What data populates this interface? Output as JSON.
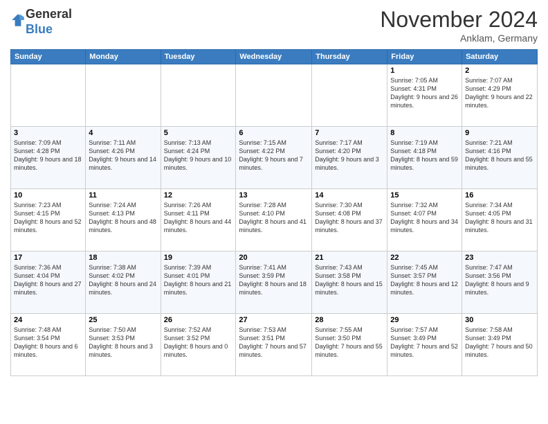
{
  "header": {
    "logo_general": "General",
    "logo_blue": "Blue",
    "month_title": "November 2024",
    "location": "Anklam, Germany"
  },
  "days_of_week": [
    "Sunday",
    "Monday",
    "Tuesday",
    "Wednesday",
    "Thursday",
    "Friday",
    "Saturday"
  ],
  "weeks": [
    [
      {
        "day": "",
        "info": ""
      },
      {
        "day": "",
        "info": ""
      },
      {
        "day": "",
        "info": ""
      },
      {
        "day": "",
        "info": ""
      },
      {
        "day": "",
        "info": ""
      },
      {
        "day": "1",
        "info": "Sunrise: 7:05 AM\nSunset: 4:31 PM\nDaylight: 9 hours and 26 minutes."
      },
      {
        "day": "2",
        "info": "Sunrise: 7:07 AM\nSunset: 4:29 PM\nDaylight: 9 hours and 22 minutes."
      }
    ],
    [
      {
        "day": "3",
        "info": "Sunrise: 7:09 AM\nSunset: 4:28 PM\nDaylight: 9 hours and 18 minutes."
      },
      {
        "day": "4",
        "info": "Sunrise: 7:11 AM\nSunset: 4:26 PM\nDaylight: 9 hours and 14 minutes."
      },
      {
        "day": "5",
        "info": "Sunrise: 7:13 AM\nSunset: 4:24 PM\nDaylight: 9 hours and 10 minutes."
      },
      {
        "day": "6",
        "info": "Sunrise: 7:15 AM\nSunset: 4:22 PM\nDaylight: 9 hours and 7 minutes."
      },
      {
        "day": "7",
        "info": "Sunrise: 7:17 AM\nSunset: 4:20 PM\nDaylight: 9 hours and 3 minutes."
      },
      {
        "day": "8",
        "info": "Sunrise: 7:19 AM\nSunset: 4:18 PM\nDaylight: 8 hours and 59 minutes."
      },
      {
        "day": "9",
        "info": "Sunrise: 7:21 AM\nSunset: 4:16 PM\nDaylight: 8 hours and 55 minutes."
      }
    ],
    [
      {
        "day": "10",
        "info": "Sunrise: 7:23 AM\nSunset: 4:15 PM\nDaylight: 8 hours and 52 minutes."
      },
      {
        "day": "11",
        "info": "Sunrise: 7:24 AM\nSunset: 4:13 PM\nDaylight: 8 hours and 48 minutes."
      },
      {
        "day": "12",
        "info": "Sunrise: 7:26 AM\nSunset: 4:11 PM\nDaylight: 8 hours and 44 minutes."
      },
      {
        "day": "13",
        "info": "Sunrise: 7:28 AM\nSunset: 4:10 PM\nDaylight: 8 hours and 41 minutes."
      },
      {
        "day": "14",
        "info": "Sunrise: 7:30 AM\nSunset: 4:08 PM\nDaylight: 8 hours and 37 minutes."
      },
      {
        "day": "15",
        "info": "Sunrise: 7:32 AM\nSunset: 4:07 PM\nDaylight: 8 hours and 34 minutes."
      },
      {
        "day": "16",
        "info": "Sunrise: 7:34 AM\nSunset: 4:05 PM\nDaylight: 8 hours and 31 minutes."
      }
    ],
    [
      {
        "day": "17",
        "info": "Sunrise: 7:36 AM\nSunset: 4:04 PM\nDaylight: 8 hours and 27 minutes."
      },
      {
        "day": "18",
        "info": "Sunrise: 7:38 AM\nSunset: 4:02 PM\nDaylight: 8 hours and 24 minutes."
      },
      {
        "day": "19",
        "info": "Sunrise: 7:39 AM\nSunset: 4:01 PM\nDaylight: 8 hours and 21 minutes."
      },
      {
        "day": "20",
        "info": "Sunrise: 7:41 AM\nSunset: 3:59 PM\nDaylight: 8 hours and 18 minutes."
      },
      {
        "day": "21",
        "info": "Sunrise: 7:43 AM\nSunset: 3:58 PM\nDaylight: 8 hours and 15 minutes."
      },
      {
        "day": "22",
        "info": "Sunrise: 7:45 AM\nSunset: 3:57 PM\nDaylight: 8 hours and 12 minutes."
      },
      {
        "day": "23",
        "info": "Sunrise: 7:47 AM\nSunset: 3:56 PM\nDaylight: 8 hours and 9 minutes."
      }
    ],
    [
      {
        "day": "24",
        "info": "Sunrise: 7:48 AM\nSunset: 3:54 PM\nDaylight: 8 hours and 6 minutes."
      },
      {
        "day": "25",
        "info": "Sunrise: 7:50 AM\nSunset: 3:53 PM\nDaylight: 8 hours and 3 minutes."
      },
      {
        "day": "26",
        "info": "Sunrise: 7:52 AM\nSunset: 3:52 PM\nDaylight: 8 hours and 0 minutes."
      },
      {
        "day": "27",
        "info": "Sunrise: 7:53 AM\nSunset: 3:51 PM\nDaylight: 7 hours and 57 minutes."
      },
      {
        "day": "28",
        "info": "Sunrise: 7:55 AM\nSunset: 3:50 PM\nDaylight: 7 hours and 55 minutes."
      },
      {
        "day": "29",
        "info": "Sunrise: 7:57 AM\nSunset: 3:49 PM\nDaylight: 7 hours and 52 minutes."
      },
      {
        "day": "30",
        "info": "Sunrise: 7:58 AM\nSunset: 3:49 PM\nDaylight: 7 hours and 50 minutes."
      }
    ]
  ]
}
